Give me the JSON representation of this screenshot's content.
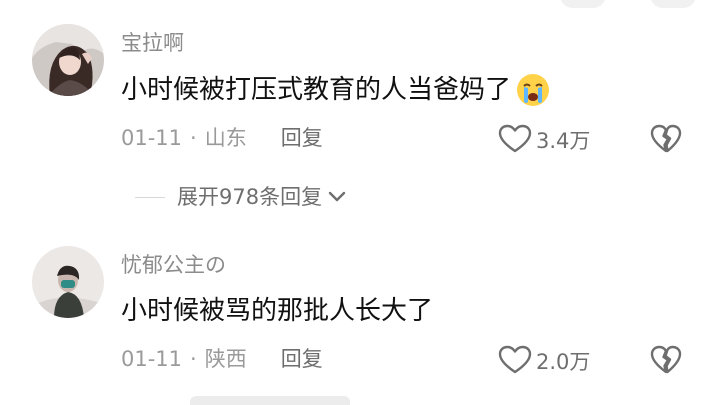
{
  "comments": [
    {
      "username": "宝拉啊",
      "text": "小时候被打压式教育的人当爸妈了",
      "emoji": "crying-face",
      "date": "01-11",
      "separator": "·",
      "location": "山东",
      "reply_label": "回复",
      "likes": "3.4万",
      "expand_label": "展开978条回复"
    },
    {
      "username": "忧郁公主の",
      "text": "小时候被骂的那批人长大了",
      "date": "01-11",
      "separator": "·",
      "location": "陕西",
      "reply_label": "回复",
      "likes": "2.0万"
    }
  ],
  "colors": {
    "username": "#8b8b8b",
    "content": "#111111",
    "meta": "#9a9a9a",
    "action": "#6e6e6e"
  },
  "icons": [
    "heart-outline-icon",
    "broken-heart-icon",
    "chevron-down-icon",
    "crying-face-emoji"
  ]
}
